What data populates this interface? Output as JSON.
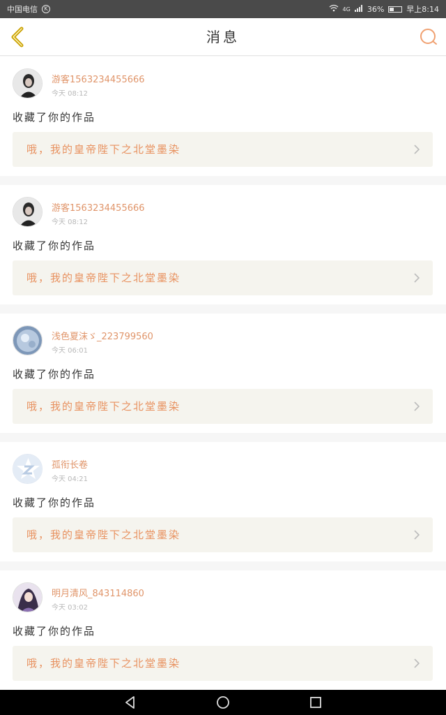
{
  "status": {
    "carrier": "中国电信",
    "carrier_badge": "K",
    "signal": "4G",
    "battery_level": 36,
    "battery": "36%",
    "time": "早上8:14"
  },
  "header": {
    "title": "消息"
  },
  "messages": [
    {
      "user": "游客1563234455666",
      "time": "今天 08:12",
      "action": "收藏了你的作品",
      "work": "哦，我的皇帝陛下之北堂墨染",
      "avatar": "photo-dark"
    },
    {
      "user": "游客1563234455666",
      "time": "今天 08:12",
      "action": "收藏了你的作品",
      "work": "哦，我的皇帝陛下之北堂墨染",
      "avatar": "photo-dark"
    },
    {
      "user": "浅色夏沫ゞ_223799560",
      "time": "今天 06:01",
      "action": "收藏了你的作品",
      "work": "哦，我的皇帝陛下之北堂墨染",
      "avatar": "photo-blue"
    },
    {
      "user": "孤衔长卷",
      "time": "今天 04:21",
      "action": "收藏了你的作品",
      "work": "哦，我的皇帝陛下之北堂墨染",
      "avatar": "default-z"
    },
    {
      "user": "明月清风_843114860",
      "time": "今天 03:02",
      "action": "收藏了你的作品",
      "work": "哦，我的皇帝陛下之北堂墨染",
      "avatar": "photo-anime"
    }
  ],
  "colors": {
    "accent": "#e8915f",
    "username": "#e0956a",
    "back_icon": "#c9a000",
    "search_icon": "#f0a070"
  }
}
